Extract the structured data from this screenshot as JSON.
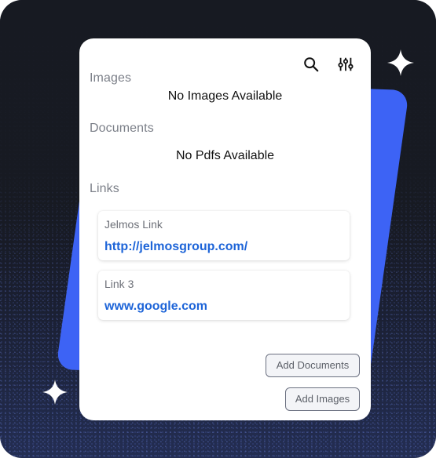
{
  "sections": {
    "images": {
      "label": "Images",
      "empty_text": "No Images Available"
    },
    "documents": {
      "label": "Documents",
      "empty_text": "No Pdfs Available"
    },
    "links": {
      "label": "Links",
      "items": [
        {
          "name": "Jelmos Link",
          "url": "http://jelmosgroup.com/"
        },
        {
          "name": "Link 3",
          "url": "www.google.com"
        }
      ]
    }
  },
  "actions": {
    "add_documents": "Add Documents",
    "add_images": "Add Images"
  },
  "icons": {
    "search": "search-icon",
    "filters": "sliders-icon",
    "sparkle": "sparkle-icon"
  },
  "colors": {
    "background": "#171a22",
    "accent": "#3d63f5",
    "link": "#1d64d8",
    "panel": "#ffffff"
  }
}
